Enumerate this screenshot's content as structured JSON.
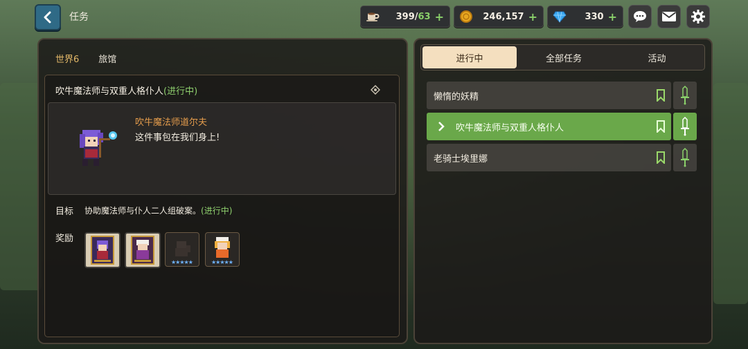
{
  "header": {
    "title": "任务"
  },
  "resources": [
    {
      "name": "coffee-icon",
      "value": "399/",
      "sub": "63",
      "plus": "+"
    },
    {
      "name": "gold-coin-icon",
      "value": "246,157",
      "sub": "",
      "plus": "+"
    },
    {
      "name": "gem-icon",
      "value": "330",
      "sub": "",
      "plus": "+"
    }
  ],
  "left_panel": {
    "tabs": [
      "世界6",
      "旅馆"
    ],
    "quest_title": "吹牛魔法师与双重人格仆人",
    "quest_status": "(进行中)",
    "npc_name": "吹牛魔法师道尔夫",
    "npc_line": "这件事包在我们身上!",
    "goal_label": "目标",
    "goal_text": "协助魔法师与仆人二人组破案。",
    "goal_status": "(进行中)",
    "reward_label": "奖励",
    "rewards": [
      {
        "name": "reward-card-wizard",
        "stars": ""
      },
      {
        "name": "reward-card-maid",
        "stars": ""
      },
      {
        "name": "reward-hero-locked",
        "stars": "★★★★★"
      },
      {
        "name": "reward-hero-girl",
        "stars": "★★★★★"
      }
    ]
  },
  "right_panel": {
    "tabs": [
      "进行中",
      "全部任务",
      "活动"
    ],
    "quests": [
      {
        "label": "懒惰的妖精",
        "active": false
      },
      {
        "label": "吹牛魔法师与双重人格仆人",
        "active": true
      },
      {
        "label": "老骑士埃里娜",
        "active": false
      }
    ]
  },
  "colors": {
    "accent_green": "#6aa84a",
    "progress_green": "#8fd06e",
    "npc_orange": "#e39b4c",
    "tab_active_bg": "#f4dfbf"
  }
}
